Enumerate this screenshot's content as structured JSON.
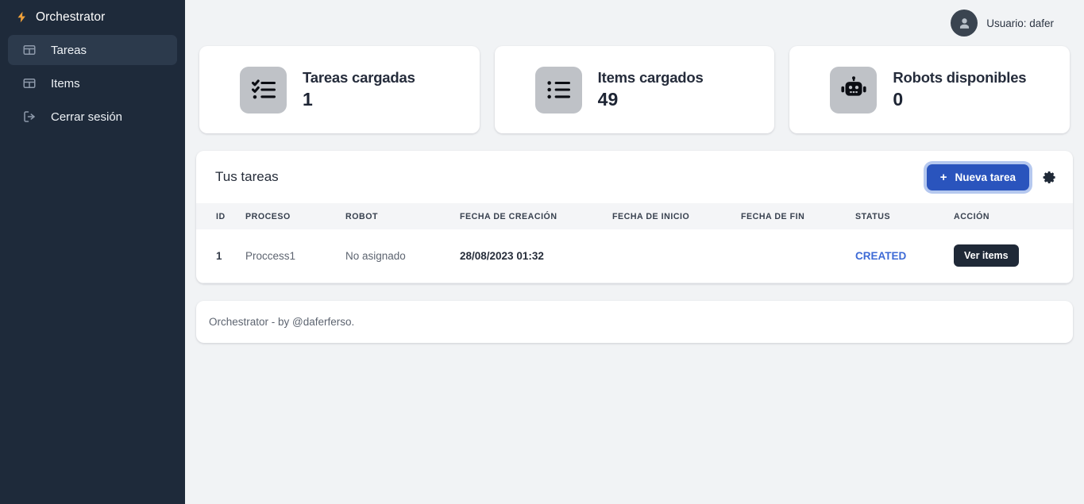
{
  "sidebar": {
    "brand": {
      "label": "Orchestrator",
      "icon": "lightning-bolt-icon"
    },
    "items": [
      {
        "label": "Tareas",
        "icon": "table-icon",
        "active": true
      },
      {
        "label": "Items",
        "icon": "table-icon",
        "active": false
      },
      {
        "label": "Cerrar sesión",
        "icon": "logout-icon",
        "active": false
      }
    ]
  },
  "topbar": {
    "user_label": "Usuario: dafer",
    "avatar_icon": "user-icon"
  },
  "cards": [
    {
      "title": "Tareas cargadas",
      "value": "1",
      "icon": "checklist-icon"
    },
    {
      "title": "Items cargados",
      "value": "49",
      "icon": "list-icon"
    },
    {
      "title": "Robots disponibles",
      "value": "0",
      "icon": "robot-icon"
    }
  ],
  "panel": {
    "title": "Tus tareas",
    "new_task_button": {
      "label": "Nueva tarea",
      "plus": "+"
    },
    "settings_icon": "gear-icon",
    "columns": [
      "ID",
      "PROCESO",
      "ROBOT",
      "FECHA DE CREACIÓN",
      "FECHA DE INICIO",
      "FECHA DE FIN",
      "STATUS",
      "ACCIÓN"
    ],
    "rows": [
      {
        "id": "1",
        "proceso": "Proccess1",
        "robot": "No asignado",
        "fecha_creacion": "28/08/2023 01:32",
        "fecha_inicio": "",
        "fecha_fin": "",
        "status": "CREATED",
        "action_label": "Ver items"
      }
    ]
  },
  "footer": {
    "text": "Orchestrator - by @daferferso."
  },
  "colors": {
    "sidebar_bg": "#1e2a3a",
    "sidebar_active": "#2c3a4c",
    "page_bg": "#f1f3f5",
    "primary_blue": "#2a54bd",
    "status_blue": "#3d6ad6",
    "dark_button": "#1f2937",
    "bolt_amber": "#f0a13a"
  }
}
